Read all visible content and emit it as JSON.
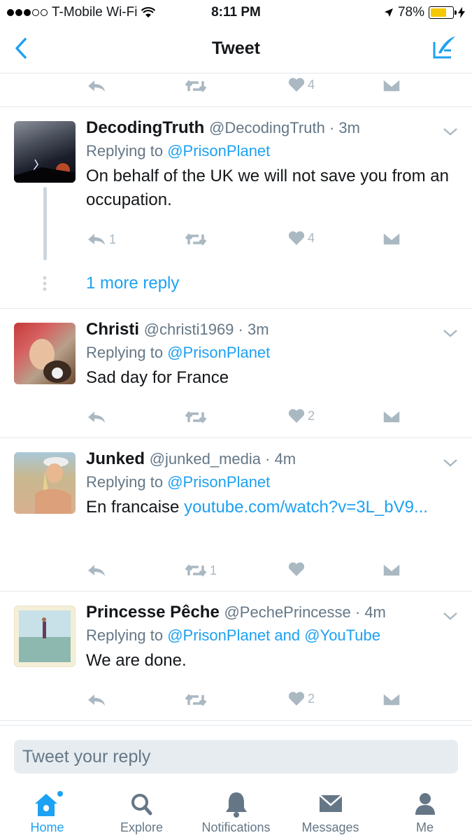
{
  "status_bar": {
    "carrier": "T-Mobile Wi-Fi",
    "time": "8:11 PM",
    "battery": "78%",
    "battery_level": 0.78
  },
  "nav": {
    "title": "Tweet"
  },
  "top_actions": {
    "like_count": "4"
  },
  "tweets": [
    {
      "name": "DecodingTruth",
      "meta": "@DecodingTruth · 3m",
      "replying_label": "Replying to",
      "replying_to": "@PrisonPlanet",
      "text": "On behalf of the UK we will not save you from an occupation.",
      "reply_count": "1",
      "retweet_count": "",
      "like_count": "4",
      "more_replies": "1 more reply"
    },
    {
      "name": "Christi",
      "meta": "@christi1969 · 3m",
      "replying_label": "Replying to",
      "replying_to": "@PrisonPlanet",
      "text": "Sad day for France",
      "reply_count": "",
      "retweet_count": "",
      "like_count": "2"
    },
    {
      "name": "Junked",
      "meta": "@junked_media · 4m",
      "replying_label": "Replying to",
      "replying_to": "@PrisonPlanet",
      "text": "En francaise",
      "link": "youtube.com/watch?v=3L_bV9...",
      "reply_count": "",
      "retweet_count": "1",
      "like_count": ""
    },
    {
      "name": "Princesse Pêche",
      "meta": "@PechePrincesse · 4m",
      "replying_label": "Replying to",
      "replying_to": "@PrisonPlanet and @YouTube",
      "text": "We are done.",
      "reply_count": "",
      "retweet_count": "",
      "like_count": "2"
    }
  ],
  "composer": {
    "placeholder": "Tweet your reply"
  },
  "tabs": [
    {
      "label": "Home",
      "icon": "home-icon",
      "active": true
    },
    {
      "label": "Explore",
      "icon": "search-icon"
    },
    {
      "label": "Notifications",
      "icon": "bell-icon"
    },
    {
      "label": "Messages",
      "icon": "envelope-icon"
    },
    {
      "label": "Me",
      "icon": "person-icon"
    }
  ],
  "colors": {
    "accent": "#1da1f2",
    "muted": "#657786",
    "icon_gray": "#aab8c2"
  }
}
